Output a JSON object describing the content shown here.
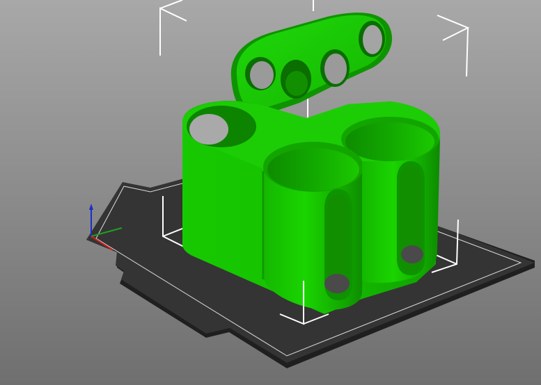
{
  "viewport": {
    "background_top": "#a8a8a8",
    "background_bottom": "#6f6f6f"
  },
  "bed": {
    "surface_color": "#343434",
    "edge_color": "#1f1f1f",
    "outline_color": "#dcdcdc"
  },
  "bounding_box": {
    "color": "#ffffff"
  },
  "model": {
    "selected": true,
    "color_base": "#16c200",
    "color_light": "#2ee21a",
    "color_dark": "#0d8c00",
    "color_shadow": "#0a6e00"
  },
  "axes": {
    "x_color": "#d02020",
    "y_color": "#20a020",
    "z_color": "#1a2ec8"
  }
}
